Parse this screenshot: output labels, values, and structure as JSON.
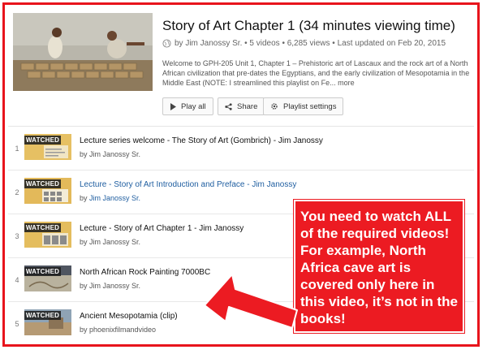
{
  "playlist": {
    "title": "Story of Art Chapter 1 (34 minutes viewing time)",
    "meta": "by Jim Janossy Sr. • 5 videos • 6,285 views • Last updated on Feb 20, 2015",
    "description": "Welcome to GPH-205 Unit 1, Chapter 1 – Prehistoric art of Lascaux and the rock art of a North African civilization that pre-dates the Egyptians, and the early civilization of Mesopotamia in the Middle East (NOTE: I streamlined this playlist on Fe...",
    "more": "more"
  },
  "actions": {
    "play_all": "Play all",
    "share": "Share",
    "settings": "Playlist settings"
  },
  "videos": [
    {
      "index": "1",
      "title": "Lecture series welcome - The Story of Art (Gombrich) - Jim Janossy",
      "channel": "by Jim Janossy Sr.",
      "badge": "WATCHED"
    },
    {
      "index": "2",
      "title": "Lecture - Story of Art Introduction and Preface - Jim Janossy",
      "channel_prefix": "by",
      "channel_link": "Jim Janossy Sr.",
      "badge": "WATCHED"
    },
    {
      "index": "3",
      "title": "Lecture - Story of Art Chapter 1 - Jim Janossy",
      "channel": "by Jim Janossy Sr.",
      "badge": "WATCHED"
    },
    {
      "index": "4",
      "title": "North African Rock Painting 7000BC",
      "channel": "by Jim Janossy Sr.",
      "badge": "WATCHED"
    },
    {
      "index": "5",
      "title": "Ancient Mesopotamia (clip)",
      "channel": "by phoenixfilmandvideo",
      "badge": "WATCHED"
    }
  ],
  "callout": {
    "text": "You need to watch ALL of the required videos! For example, North Africa cave art is covered only here in this video, it’s not in the books!"
  },
  "colors": {
    "accent_red": "#ec1b22",
    "link_blue": "#1f5ea0"
  }
}
